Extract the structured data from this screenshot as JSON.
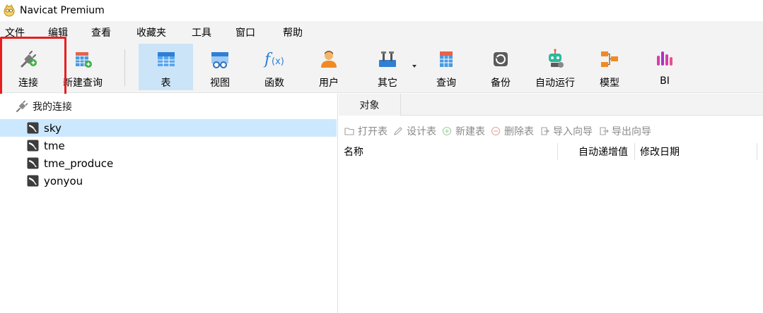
{
  "window": {
    "title": "Navicat Premium"
  },
  "menu": [
    "文件",
    "编辑",
    "查看",
    "收藏夹",
    "工具",
    "窗口",
    "帮助"
  ],
  "toolbar": {
    "connect": "连接",
    "new_query": "新建查询",
    "table": "表",
    "view": "视图",
    "function": "函数",
    "user": "用户",
    "other": "其它",
    "query": "查询",
    "backup": "备份",
    "automation": "自动运行",
    "model": "模型",
    "bi": "BI"
  },
  "tree": {
    "root": "我的连接",
    "items": [
      "sky",
      "tme",
      "tme_produce",
      "yonyou"
    ]
  },
  "tabs": {
    "objects": "对象"
  },
  "object_toolbar": {
    "open_table": "打开表",
    "design_table": "设计表",
    "new_table": "新建表",
    "delete_table": "删除表",
    "import_wizard": "导入向导",
    "export_wizard": "导出向导"
  },
  "columns": {
    "name": "名称",
    "auto_increment": "自动递增值",
    "modified_date": "修改日期"
  },
  "colors": {
    "accent": "#cce4f7",
    "selection": "#cce8ff",
    "highlight": "#e81e1e"
  }
}
